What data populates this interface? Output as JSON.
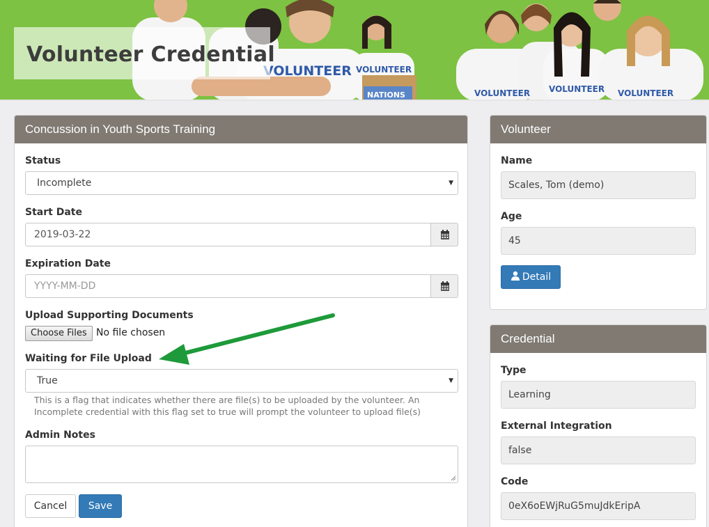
{
  "banner": {
    "title": "Volunteer Credential",
    "shirt_text": "VOLUNTEER",
    "box_text": "NATIONS"
  },
  "training": {
    "heading": "Concussion in Youth Sports Training",
    "status": {
      "label": "Status",
      "value": "Incomplete"
    },
    "start_date": {
      "label": "Start Date",
      "value": "2019-03-22"
    },
    "expiration_date": {
      "label": "Expiration Date",
      "placeholder": "YYYY-MM-DD"
    },
    "upload": {
      "label": "Upload Supporting Documents",
      "button": "Choose Files",
      "status": "No file chosen"
    },
    "waiting": {
      "label": "Waiting for File Upload",
      "value": "True",
      "help_line1": "This is a flag that indicates whether there are file(s) to be uploaded by the volunteer. An",
      "help_line2": "Incomplete credential with this flag set to true will prompt the volunteer to upload file(s)"
    },
    "admin_notes": {
      "label": "Admin Notes"
    },
    "cancel_label": "Cancel",
    "save_label": "Save"
  },
  "volunteer": {
    "heading": "Volunteer",
    "name_label": "Name",
    "name_value": "Scales, Tom (demo)",
    "age_label": "Age",
    "age_value": "45",
    "detail_label": "Detail"
  },
  "credential": {
    "heading": "Credential",
    "type_label": "Type",
    "type_value": "Learning",
    "external_label": "External Integration",
    "external_value": "false",
    "code_label": "Code",
    "code_value": "0eX6oEWjRuG5muJdkEripA"
  },
  "colors": {
    "banner_green": "#7dc242",
    "panel_heading": "#807a73",
    "primary": "#337ab7",
    "annotation_arrow": "#1e9a3a"
  },
  "icons": {
    "calendar": "calendar-icon",
    "user": "user-icon",
    "caret": "caret-down-icon",
    "arrow": "annotation-arrow-icon"
  }
}
